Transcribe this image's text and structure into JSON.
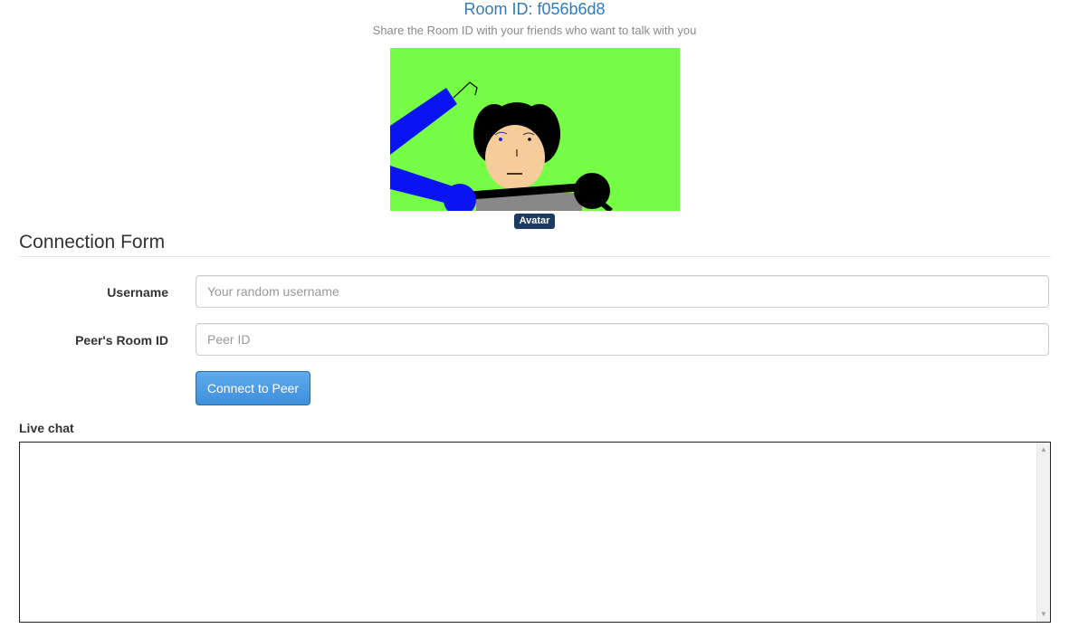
{
  "header": {
    "room_id_text": "Room ID: f056b6d8",
    "subtitle": "Share the Room ID with your friends who want to talk with you"
  },
  "avatar": {
    "badge_label": "Avatar",
    "background_color": "#76fd45"
  },
  "form": {
    "legend": "Connection Form",
    "username_label": "Username",
    "username_placeholder": "Your random username",
    "username_value": "",
    "peer_label": "Peer's Room ID",
    "peer_placeholder": "Peer ID",
    "peer_value": "",
    "connect_label": "Connect to Peer"
  },
  "chat": {
    "label": "Live chat",
    "content": ""
  },
  "colors": {
    "accent": "#337ab7",
    "button": "#4a9be2",
    "badge": "#1d3a62"
  }
}
